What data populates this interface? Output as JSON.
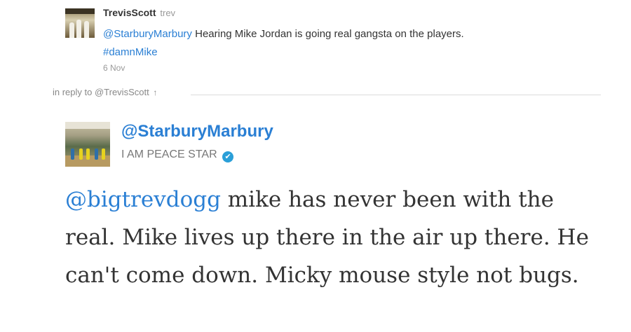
{
  "reply_tweet": {
    "name": "TrevisScott",
    "handle": "trev",
    "mention": "@StarburyMarbury",
    "text": " Hearing Mike Jordan is going real gangsta on the players.",
    "hashtag": "#damnMike",
    "time": "6 Nov"
  },
  "in_reply_to": {
    "label": "in reply to @TrevisScott",
    "arrow": "↑"
  },
  "main_tweet": {
    "name": "@StarburyMarbury",
    "bio": "I AM PEACE STAR",
    "verified_icon": "✔",
    "mention": "@bigtrevdogg",
    "text": " mike has never been with the real. Mike lives up there in the air up there. He can't come down. Micky mouse style not bugs."
  },
  "colors": {
    "link": "#2a7fd4",
    "verified": "#2a9fd8"
  }
}
